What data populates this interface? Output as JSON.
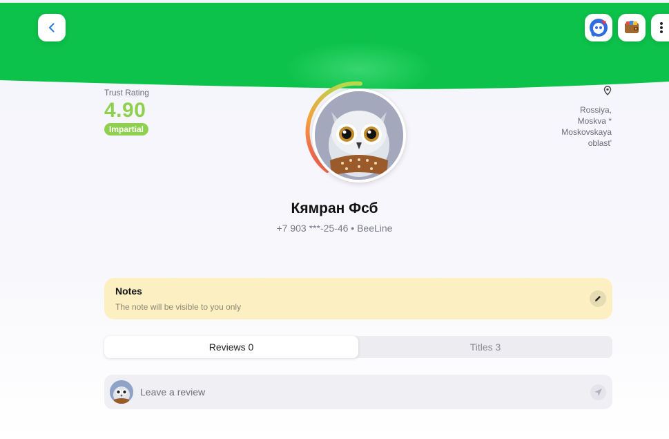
{
  "colors": {
    "header_green": "#0cc24a",
    "trust_green": "#8fd14f",
    "notes_bg": "#fcf0c2",
    "tab_bg": "#ececf1"
  },
  "header": {
    "back_icon": "chevron-left-icon",
    "actions": [
      "bot-icon",
      "wallet-icon",
      "more-vertical-icon"
    ]
  },
  "trust": {
    "label": "Trust Rating",
    "value": "4.90",
    "badge": "Impartial"
  },
  "location": {
    "icon": "map-pin-icon",
    "line1": "Rossiya,",
    "line2": "Moskva *",
    "line3": "Moskovskaya",
    "line4": "oblast'"
  },
  "profile": {
    "name": "Кямран Фсб",
    "phone": "+7 903 ***-25-46 • BeeLine"
  },
  "notes": {
    "title": "Notes",
    "subtitle": "The note will be visible to you only",
    "edit_icon": "pencil-icon"
  },
  "tabs": [
    {
      "label": "Reviews 0",
      "active": true
    },
    {
      "label": "Titles 3",
      "active": false
    }
  ],
  "review": {
    "placeholder": "Leave a review",
    "send_icon": "send-icon"
  }
}
